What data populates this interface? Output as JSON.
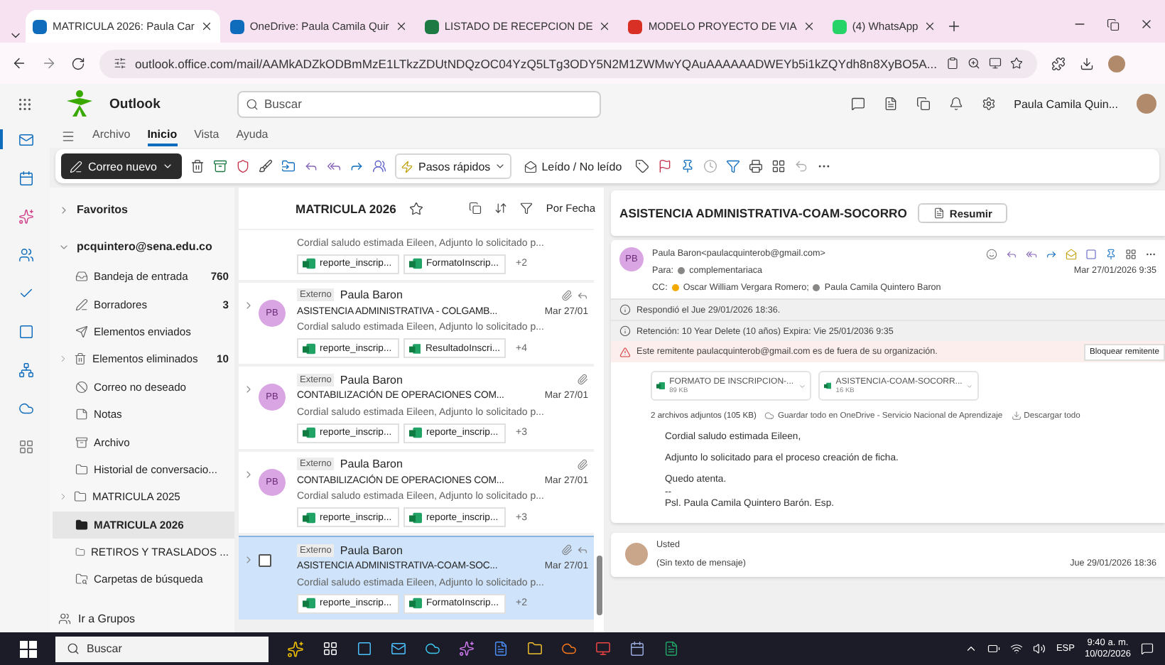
{
  "browser": {
    "tabs": [
      {
        "label": "MATRICULA 2026: Paula Car",
        "selected": true
      },
      {
        "label": "OneDrive: Paula Camila Quir",
        "selected": false
      },
      {
        "label": "LISTADO DE RECEPCION DE",
        "selected": false
      },
      {
        "label": "MODELO PROYECTO DE VIA",
        "selected": false
      },
      {
        "label": "(4) WhatsApp",
        "selected": false
      }
    ],
    "url": "outlook.office.com/mail/AAMkADZkODBmMzE1LTkzZDUtNDQzOC04YzQ5LTg3ODY5N2M1ZWMwYQAuAAAAAADWEYb5i1kZQYdh8n8XyBO5A..."
  },
  "app": {
    "name": "Outlook",
    "search_placeholder": "Buscar",
    "user": "Paula Camila Quin..."
  },
  "ribbon_tabs": [
    {
      "label": "Archivo",
      "selected": false
    },
    {
      "label": "Inicio",
      "selected": true
    },
    {
      "label": "Vista",
      "selected": false
    },
    {
      "label": "Ayuda",
      "selected": false
    }
  ],
  "toolbar": {
    "new_mail": "Correo nuevo",
    "quick_steps": "Pasos rápidos",
    "read_unread": "Leído / No leído"
  },
  "folders": {
    "favorites": "Favoritos",
    "account": "pcquintero@sena.edu.co",
    "groups": "Ir a Grupos",
    "items": [
      {
        "label": "Bandeja de entrada",
        "count": "760",
        "expandable": false,
        "selected": false
      },
      {
        "label": "Borradores",
        "count": "3",
        "expandable": false,
        "selected": false
      },
      {
        "label": "Elementos enviados",
        "expandable": false,
        "selected": false
      },
      {
        "label": "Elementos eliminados",
        "count": "10",
        "expandable": true,
        "selected": false
      },
      {
        "label": "Correo no deseado",
        "expandable": false,
        "selected": false
      },
      {
        "label": "Notas",
        "expandable": false,
        "selected": false
      },
      {
        "label": "Archivo",
        "expandable": false,
        "selected": false
      },
      {
        "label": "Historial de conversacio...",
        "expandable": false,
        "selected": false
      },
      {
        "label": "MATRICULA 2025",
        "expandable": true,
        "selected": false
      },
      {
        "label": "MATRICULA 2026",
        "expandable": false,
        "selected": true
      },
      {
        "label": "RETIROS Y TRASLADOS ...",
        "expandable": false,
        "selected": false
      },
      {
        "label": "Carpetas de búsqueda",
        "expandable": false,
        "selected": false
      }
    ]
  },
  "message_list": {
    "title": "MATRICULA 2026",
    "sort": "Por Fecha",
    "messages": [
      {
        "kind": "partial",
        "preview": "Cordial saludo estimada Eileen, Adjunto lo solicitado p...",
        "attachments": [
          "reporte_inscrip...",
          "FormatoInscrip..."
        ],
        "more": "+2",
        "selected": false
      },
      {
        "kind": "full",
        "tag": "Externo",
        "initials": "PB",
        "sender": "Paula Baron",
        "subject": "ASISTENCIA ADMINISTRATIVA - COLGAMB...",
        "date": "Mar 27/01",
        "preview": "Cordial saludo estimada Eileen, Adjunto lo solicitado p...",
        "attachments": [
          "reporte_inscrip...",
          "ResultadoInscri..."
        ],
        "more": "+4",
        "replied": true,
        "selected": false
      },
      {
        "kind": "full",
        "tag": "Externo",
        "initials": "PB",
        "sender": "Paula Baron",
        "subject": "CONTABILIZACIÓN DE OPERACIONES COM...",
        "date": "Mar 27/01",
        "preview": "Cordial saludo estimada Eileen, Adjunto lo solicitado p...",
        "attachments": [
          "reporte_inscrip...",
          "reporte_inscrip..."
        ],
        "more": "+3",
        "replied": false,
        "selected": false
      },
      {
        "kind": "full",
        "tag": "Externo",
        "initials": "PB",
        "sender": "Paula Baron",
        "subject": "CONTABILIZACIÓN DE OPERACIONES COM...",
        "date": "Mar 27/01",
        "preview": "Cordial saludo estimada Eileen, Adjunto lo solicitado p...",
        "attachments": [
          "reporte_inscrip...",
          "reporte_inscrip..."
        ],
        "more": "+3",
        "replied": false,
        "selected": false
      },
      {
        "kind": "full",
        "tag": "Externo",
        "sender": "Paula Baron",
        "subject": "ASISTENCIA ADMINISTRATIVA-COAM-SOC...",
        "date": "Mar 27/01",
        "preview": "Cordial saludo estimada Eileen, Adjunto lo solicitado p...",
        "attachments": [
          "reporte_inscrip...",
          "FormatoInscrip..."
        ],
        "more": "+2",
        "replied": true,
        "selected": true
      }
    ]
  },
  "reading": {
    "subject": "ASISTENCIA ADMINISTRATIVA-COAM-SOCORRO",
    "summarize": "Resumir",
    "from": "Paula Baron<paulacquinterob@gmail.com>",
    "initials": "PB",
    "to_label": "Para:",
    "to": "complementariaca",
    "date": "Mar 27/01/2026 9:35",
    "cc_label": "CC:",
    "cc": [
      {
        "name": "Oscar William Vergara Romero;",
        "color": "#f2a900"
      },
      {
        "name": "Paula Camila Quintero Baron",
        "color": "#8a8886"
      }
    ],
    "notices": [
      "Respondió el Jue 29/01/2026 18:36.",
      "Retención: 10 Year Delete (10 años) Expira: Vie 25/01/2036 9:35"
    ],
    "warning": "Este remitente paulacquinterob@gmail.com es de fuera de su organización.",
    "block": "Bloquear remitente",
    "attachments": [
      {
        "name": "FORMATO DE INSCRIPCION-...",
        "size": "89 KB"
      },
      {
        "name": "ASISTENCIA-COAM-SOCORR...",
        "size": "16 KB"
      }
    ],
    "attachments_summary": "2 archivos adjuntos (105 KB)",
    "save_all": "Guardar todo en OneDrive - Servicio Nacional de Aprendizaje",
    "download_all": "Descargar todo",
    "body": [
      "Cordial saludo estimada Eileen,",
      "Adjunto lo solicitado para el proceso creación de ficha.",
      "Quedo atenta."
    ],
    "signature": [
      "--",
      "Psl. Paula Camila Quintero Barón. Esp."
    ],
    "reply": {
      "sender": "Usted",
      "preview": "(Sin texto de mensaje)",
      "date": "Jue 29/01/2026 18:36"
    }
  },
  "taskbar": {
    "search": "Buscar",
    "language": "ESP",
    "time": "9:40 a. m.",
    "date": "10/02/2026"
  }
}
